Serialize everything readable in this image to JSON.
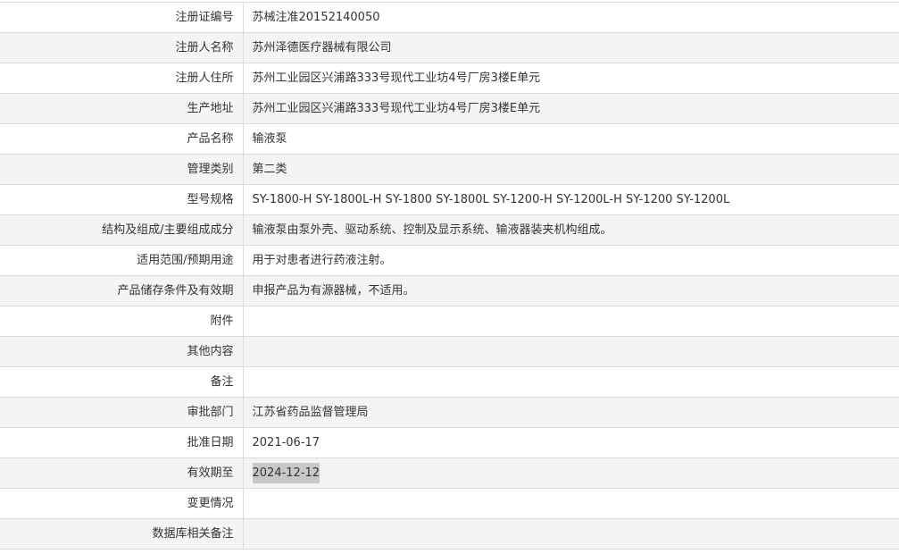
{
  "rows": [
    {
      "label": "注册证编号",
      "value": "苏械注准20152140050"
    },
    {
      "label": "注册人名称",
      "value": "苏州泽德医疗器械有限公司"
    },
    {
      "label": "注册人住所",
      "value": "苏州工业园区兴浦路333号现代工业坊4号厂房3楼E单元"
    },
    {
      "label": "生产地址",
      "value": "苏州工业园区兴浦路333号现代工业坊4号厂房3楼E单元"
    },
    {
      "label": "产品名称",
      "value": "输液泵"
    },
    {
      "label": "管理类别",
      "value": "第二类"
    },
    {
      "label": "型号规格",
      "value": "SY-1800-H SY-1800L-H SY-1800 SY-1800L SY-1200-H SY-1200L-H SY-1200 SY-1200L"
    },
    {
      "label": "结构及组成/主要组成成分",
      "value": "输液泵由泵外壳、驱动系统、控制及显示系统、输液器装夹机构组成。"
    },
    {
      "label": "适用范围/预期用途",
      "value": "用于对患者进行药液注射。"
    },
    {
      "label": "产品储存条件及有效期",
      "value": "申报产品为有源器械，不适用。"
    },
    {
      "label": "附件",
      "value": ""
    },
    {
      "label": "其他内容",
      "value": ""
    },
    {
      "label": "备注",
      "value": ""
    },
    {
      "label": "审批部门",
      "value": "江苏省药品监督管理局"
    },
    {
      "label": "批准日期",
      "value": "2021-06-17"
    },
    {
      "label": "有效期至",
      "value": "2024-12-12",
      "selected": true
    },
    {
      "label": "变更情况",
      "value": ""
    },
    {
      "label": "数据库相关备注",
      "value": ""
    }
  ]
}
